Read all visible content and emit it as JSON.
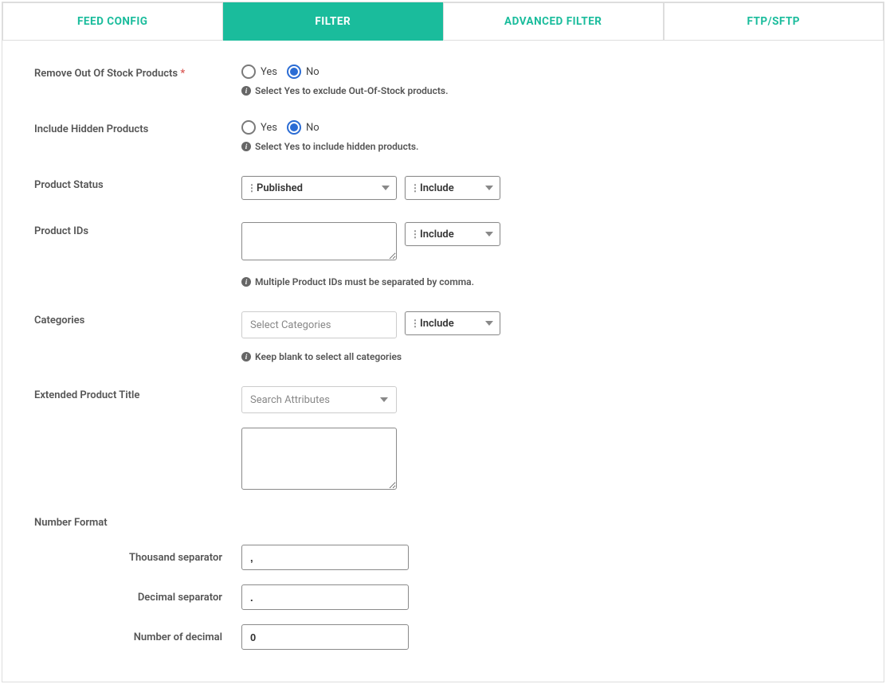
{
  "tabs": [
    {
      "label": "FEED CONFIG",
      "active": false
    },
    {
      "label": "FILTER",
      "active": true
    },
    {
      "label": "ADVANCED FILTER",
      "active": false
    },
    {
      "label": "FTP/SFTP",
      "active": false
    }
  ],
  "labels": {
    "removeOos": "Remove Out Of Stock Products",
    "includeHidden": "Include Hidden Products",
    "productStatus": "Product Status",
    "productIds": "Product IDs",
    "categories": "Categories",
    "extendedTitle": "Extended Product Title",
    "numberFormat": "Number Format",
    "thousandSep": "Thousand separator",
    "decimalSep": "Decimal separator",
    "numDecimal": "Number of decimal",
    "yes": "Yes",
    "no": "No"
  },
  "hints": {
    "removeOos": "Select Yes to exclude Out-Of-Stock products.",
    "includeHidden": "Select Yes to include hidden products.",
    "productIds": "Multiple Product IDs must be separated by comma.",
    "categories": "Keep blank to select all categories"
  },
  "values": {
    "removeOos": "No",
    "includeHidden": "No",
    "productStatus": "Published",
    "productStatusMode": "Include",
    "productIds": "",
    "productIdsMode": "Include",
    "categoriesPlaceholder": "Select Categories",
    "categoriesMode": "Include",
    "attrPlaceholder": "Search Attributes",
    "extendedTitle": "",
    "thousandSep": ",",
    "decimalSep": ".",
    "numDecimal": "0"
  }
}
